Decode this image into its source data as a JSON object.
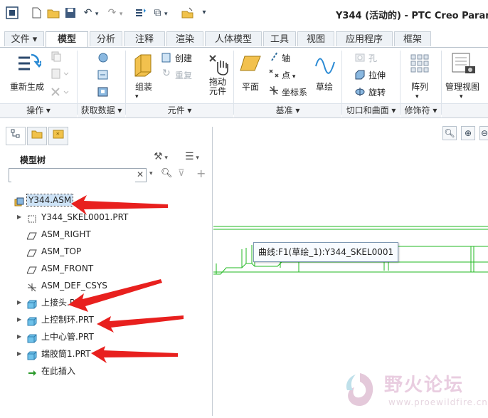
{
  "titlebar": {
    "title": "Y344 (活动的) - PTC Creo Param",
    "quick_access_icons": [
      "app-icon",
      "new-icon",
      "open-icon",
      "save-icon",
      "undo-icon",
      "redo-icon",
      "regenerate-icon",
      "window-icon",
      "close-window-icon",
      "customize-icon"
    ]
  },
  "tabs": [
    {
      "label": "文件 ▾"
    },
    {
      "label": "模型"
    },
    {
      "label": "分析"
    },
    {
      "label": "注释"
    },
    {
      "label": "渲染"
    },
    {
      "label": "人体模型"
    },
    {
      "label": "工具"
    },
    {
      "label": "视图"
    },
    {
      "label": "应用程序"
    },
    {
      "label": "框架"
    }
  ],
  "ribbon": {
    "regenerate": "重新生成",
    "create": "创建",
    "repeat": "重复",
    "assemble": "组装",
    "drag_line1": "拖动",
    "drag_line2": "元件",
    "plane": "平面",
    "axis": "轴",
    "point": "点",
    "csys": "坐标系",
    "sketch": "草绘",
    "hole": "孔",
    "extrude": "拉伸",
    "revolve": "旋转",
    "pattern": "阵列",
    "manage_views": "管理视图",
    "groups": [
      {
        "label": "操作 ▾"
      },
      {
        "label": "获取数据 ▾"
      },
      {
        "label": "元件 ▾"
      },
      {
        "label": "基准 ▾"
      },
      {
        "label": "切口和曲面 ▾"
      },
      {
        "label": "修饰符 ▾"
      }
    ]
  },
  "panel": {
    "title": "模型树",
    "search_value": "",
    "tree": [
      {
        "label": "Y344.ASM",
        "icon": "assembly-icon",
        "expand": "",
        "selected": true
      },
      {
        "label": "Y344_SKEL0001.PRT",
        "icon": "skeleton-icon",
        "expand": "▶"
      },
      {
        "label": "ASM_RIGHT",
        "icon": "datum-plane-icon",
        "expand": ""
      },
      {
        "label": "ASM_TOP",
        "icon": "datum-plane-icon",
        "expand": ""
      },
      {
        "label": "ASM_FRONT",
        "icon": "datum-plane-icon",
        "expand": ""
      },
      {
        "label": "ASM_DEF_CSYS",
        "icon": "csys-icon",
        "expand": ""
      },
      {
        "label": "上接头.PRT",
        "icon": "part-icon",
        "expand": "▶"
      },
      {
        "label": "上控制环.PRT",
        "icon": "part-icon",
        "expand": "▶"
      },
      {
        "label": "上中心管.PRT",
        "icon": "part-icon",
        "expand": "▶"
      },
      {
        "label": "端胶筒1.PRT",
        "icon": "part-icon",
        "expand": "▶"
      },
      {
        "label": "在此插入",
        "icon": "insert-here-icon",
        "expand": ""
      }
    ]
  },
  "tooltip": "曲线:F1(草绘_1):Y344_SKEL0001",
  "watermark": {
    "text": "野火论坛",
    "url": "www.proewildfire.cn"
  },
  "colors": {
    "accent": "#2f6fb0",
    "annotation_arrow": "#e8201e",
    "geometry": "#22b822"
  }
}
